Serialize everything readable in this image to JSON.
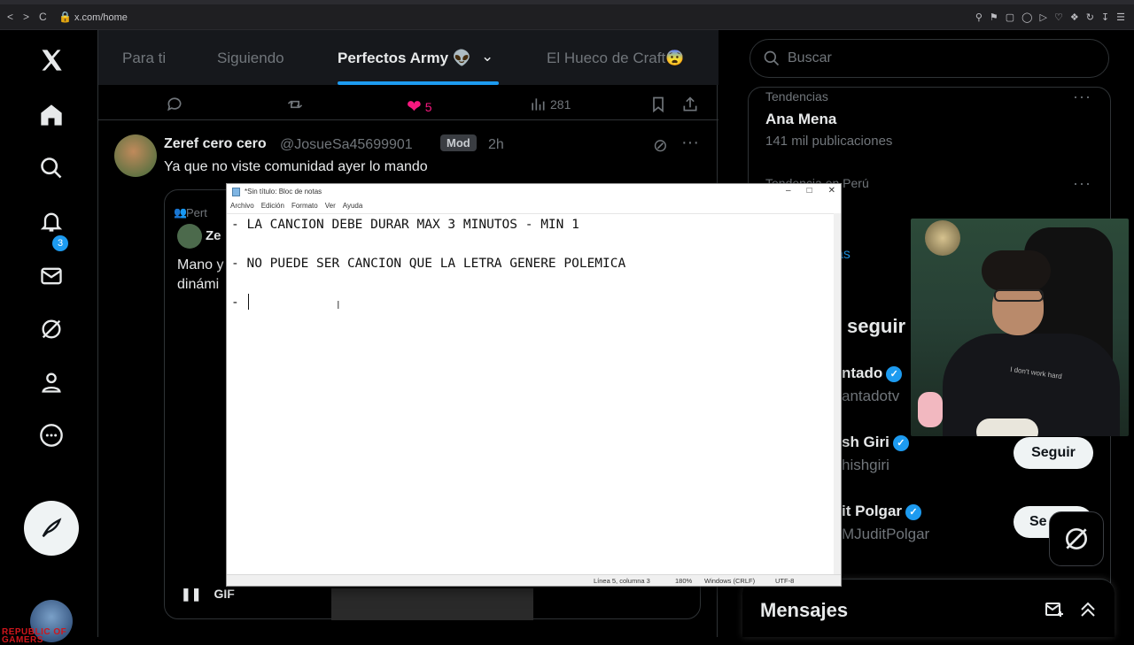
{
  "browser": {
    "url": "x.com/home",
    "back": "<",
    "forward": ">",
    "reload": "C"
  },
  "left_nav": {
    "notifications_badge": "3",
    "brand_logo": "REPUBLIC OF GAMERS"
  },
  "tabs": [
    {
      "label": "Para ti"
    },
    {
      "label": "Siguiendo"
    },
    {
      "label": "Perfectos Army 👽"
    },
    {
      "label": "El Hueco de Craft😨"
    }
  ],
  "actions": {
    "likes": "5",
    "views": "281"
  },
  "tweet": {
    "name": "Zeref cero cero",
    "handle": "@JosueSa45699901",
    "badge": "Mod",
    "time": "2h",
    "text": "Ya que no viste comunidad ayer lo mando",
    "quote_label": "Pert",
    "quote_name": "Ze",
    "quote_text_1": "Mano y",
    "quote_text_2": "dinámi",
    "gif_label": "GIF"
  },
  "right": {
    "search_placeholder": "Buscar",
    "trend1_category": "Tendencias",
    "trend1_name": "Ana Mena",
    "trend1_count": "141 mil publicaciones",
    "trend2_category": "Tendencia en Perú",
    "trend2_link": "ás",
    "follow_title": "seguir",
    "follows": [
      {
        "name": "ntado",
        "handle": "antadotv"
      },
      {
        "name": "sh Giri",
        "handle": "hishgiri"
      },
      {
        "name": "it Polgar",
        "handle": "MJuditPolgar"
      }
    ],
    "follow_button": "Seguir",
    "follow_button_partial": "Se",
    "messages_title": "Mensajes"
  },
  "webcam": {
    "shirt_text": "I don't work hard"
  },
  "notepad": {
    "title": "*Sin título: Bloc de notas",
    "menu": [
      "Archivo",
      "Edición",
      "Formato",
      "Ver",
      "Ayuda"
    ],
    "lines": [
      "- LA CANCION DEBE DURAR MAX 3 MINUTOS - MIN 1",
      "",
      "- NO PUEDE SER CANCION QUE LA LETRA GENERE POLEMICA",
      "",
      "- "
    ],
    "status_pos": "Línea 5, columna 3",
    "status_zoom": "180%",
    "status_eol": "Windows (CRLF)",
    "status_enc": "UTF-8"
  }
}
